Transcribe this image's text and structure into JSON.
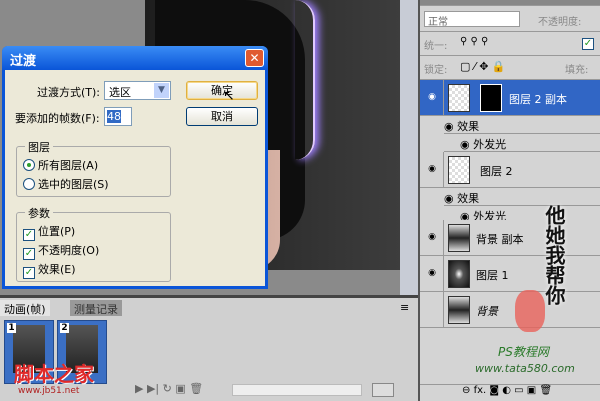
{
  "dialog": {
    "title": "过渡",
    "method_label": "过渡方式(T):",
    "method_value": "选区",
    "frames_label": "要添加的帧数(F):",
    "frames_value": "48",
    "ok_label": "确定",
    "cancel_label": "取消",
    "layers_group": {
      "title": "图层",
      "options": [
        {
          "label": "所有图层(A)",
          "selected": true
        },
        {
          "label": "选中的图层(S)",
          "selected": false
        }
      ]
    },
    "params_group": {
      "title": "参数",
      "options": [
        {
          "label": "位置(P)",
          "checked": true
        },
        {
          "label": "不透明度(O)",
          "checked": true
        },
        {
          "label": "效果(E)",
          "checked": true
        }
      ]
    }
  },
  "layers_panel": {
    "blend_mode": "正常",
    "opacity_label": "不透明度:",
    "unify_label": "统一:",
    "lock_label": "锁定:",
    "fill_label": "填充:",
    "layers": [
      {
        "name": "图层 2 副本",
        "visible": true,
        "selected": true,
        "effects": [
          "效果",
          "外发光"
        ]
      },
      {
        "name": "图层 2",
        "visible": true,
        "selected": false,
        "effects": [
          "效果",
          "外发光"
        ]
      },
      {
        "name": "背景 副本",
        "visible": true,
        "selected": false,
        "effects": []
      },
      {
        "name": "图层 1",
        "visible": true,
        "selected": false,
        "effects": []
      },
      {
        "name": "背景",
        "visible": false,
        "selected": false,
        "effects": []
      }
    ]
  },
  "animation_panel": {
    "tabs": [
      "动画(帧)",
      "测量记录"
    ],
    "frames": [
      "1",
      "2"
    ]
  },
  "watermarks": {
    "left": "脚本之家",
    "left_url": "www.jb51.net",
    "right_cn": "他她我帮你",
    "right_site": "PS教程网",
    "right_url": "www.tata580.com"
  },
  "colors": {
    "accent": "#3166c5",
    "title_bar": "#0a55d8"
  }
}
